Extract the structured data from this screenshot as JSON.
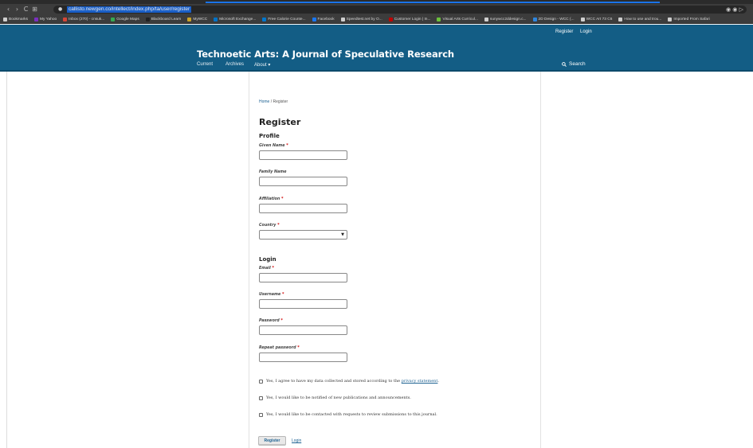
{
  "browser": {
    "url": "callisto.newgen.co/intellect/index.php/ta/user/register",
    "nav_back": "‹",
    "nav_forward": "›",
    "nav_reload": "C",
    "nav_apps": "⊞",
    "bookmarks": [
      {
        "label": "Bookmarks",
        "color": "#cfcfcf"
      },
      {
        "label": "My Yahoo",
        "color": "#7b2fbf"
      },
      {
        "label": "Inbox (270) - cnsuk...",
        "color": "#d44638"
      },
      {
        "label": "Google Maps",
        "color": "#34a853"
      },
      {
        "label": "Blackboard Learn",
        "color": "#222222"
      },
      {
        "label": "MyWCC",
        "color": "#c9a227"
      },
      {
        "label": "Microsoft Exchange...",
        "color": "#0072c6"
      },
      {
        "label": "Free Calorie Counte...",
        "color": "#0077cc"
      },
      {
        "label": "Facebook",
        "color": "#1877f2"
      },
      {
        "label": "Speedtest.net by O...",
        "color": "#cfcfcf"
      },
      {
        "label": "Customer Login | In...",
        "color": "#c00000"
      },
      {
        "label": "Visual Arts Curricul...",
        "color": "#6bbf3b"
      },
      {
        "label": "sunywcc2ddesign.c...",
        "color": "#cfcfcf"
      },
      {
        "label": "2D Design - WCC (...",
        "color": "#2e86de"
      },
      {
        "label": "WCC Art 73 C6",
        "color": "#cfcfcf"
      },
      {
        "label": "How to use and trou...",
        "color": "#cfcfcf"
      },
      {
        "label": "Imported From Safari",
        "color": "#cfcfcf"
      }
    ]
  },
  "header": {
    "register_link": "Register",
    "login_link": "Login",
    "site_title": "Technoetic Arts: A Journal of Speculative Research",
    "nav_current": "Current",
    "nav_archives": "Archives",
    "nav_about": "About ▾",
    "search_label": "Search"
  },
  "breadcrumb": {
    "home": "Home",
    "separator": "/",
    "current": "Register"
  },
  "page_title": "Register",
  "profile": {
    "title": "Profile",
    "given_name_label": "Given Name",
    "family_name_label": "Family Name",
    "affiliation_label": "Affiliation",
    "country_label": "Country",
    "required_mark": "*"
  },
  "login_section": {
    "title": "Login",
    "email_label": "Email",
    "username_label": "Username",
    "password_label": "Password",
    "repeat_password_label": "Repeat password"
  },
  "consent": {
    "privacy_prefix": "Yes, I agree to have my data collected and stored according to the",
    "privacy_link": "privacy statement",
    "privacy_suffix": ".",
    "notify": "Yes, I would like to be notified of new publications and announcements.",
    "review": "Yes, I would like to be contacted with requests to review submissions to this journal."
  },
  "actions": {
    "register_button": "Register",
    "login_link": "Login"
  },
  "colors": {
    "header_bg": "#135d85",
    "link": "#1e6292",
    "required": "#d00a0a"
  }
}
